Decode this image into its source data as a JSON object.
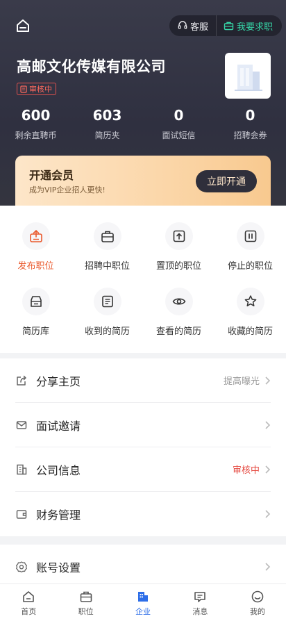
{
  "header": {
    "service_label": "客服",
    "job_label": "我要求职",
    "company_name": "高邮文化传媒有限公司",
    "review_badge": "审核中"
  },
  "stats": [
    {
      "value": "600",
      "label": "剩余直聘币"
    },
    {
      "value": "603",
      "label": "简历夹"
    },
    {
      "value": "0",
      "label": "面试短信"
    },
    {
      "value": "0",
      "label": "招聘会券"
    }
  ],
  "vip": {
    "title": "开通会员",
    "subtitle": "成为VIP企业招人更快!",
    "button": "立即开通"
  },
  "grid": [
    {
      "label": "发布职位",
      "icon": "publish-job-icon"
    },
    {
      "label": "招聘中职位",
      "icon": "briefcase-icon"
    },
    {
      "label": "置顶的职位",
      "icon": "pin-top-icon"
    },
    {
      "label": "停止的职位",
      "icon": "pause-icon"
    },
    {
      "label": "简历库",
      "icon": "resume-box-icon"
    },
    {
      "label": "收到的简历",
      "icon": "resume-received-icon"
    },
    {
      "label": "查看的简历",
      "icon": "eye-icon"
    },
    {
      "label": "收藏的简历",
      "icon": "star-icon"
    }
  ],
  "list1": [
    {
      "title": "分享主页",
      "extra": "提高曝光",
      "icon": "share-icon"
    },
    {
      "title": "面试邀请",
      "extra": "",
      "icon": "mail-icon"
    },
    {
      "title": "公司信息",
      "extra": "审核中",
      "icon": "building-icon"
    },
    {
      "title": "财务管理",
      "extra": "",
      "icon": "wallet-icon"
    }
  ],
  "list2": [
    {
      "title": "账号设置",
      "extra": "",
      "icon": "gear-icon"
    }
  ],
  "tabs": [
    {
      "label": "首页",
      "icon": "home-icon"
    },
    {
      "label": "职位",
      "icon": "briefcase-icon"
    },
    {
      "label": "企业",
      "icon": "company-icon"
    },
    {
      "label": "消息",
      "icon": "message-icon"
    },
    {
      "label": "我的",
      "icon": "profile-icon"
    }
  ],
  "colors": {
    "accent_orange": "#ea5a2e",
    "accent_blue": "#2d6ee8",
    "accent_green": "#36d6a7",
    "warn_red": "#e5483f"
  }
}
